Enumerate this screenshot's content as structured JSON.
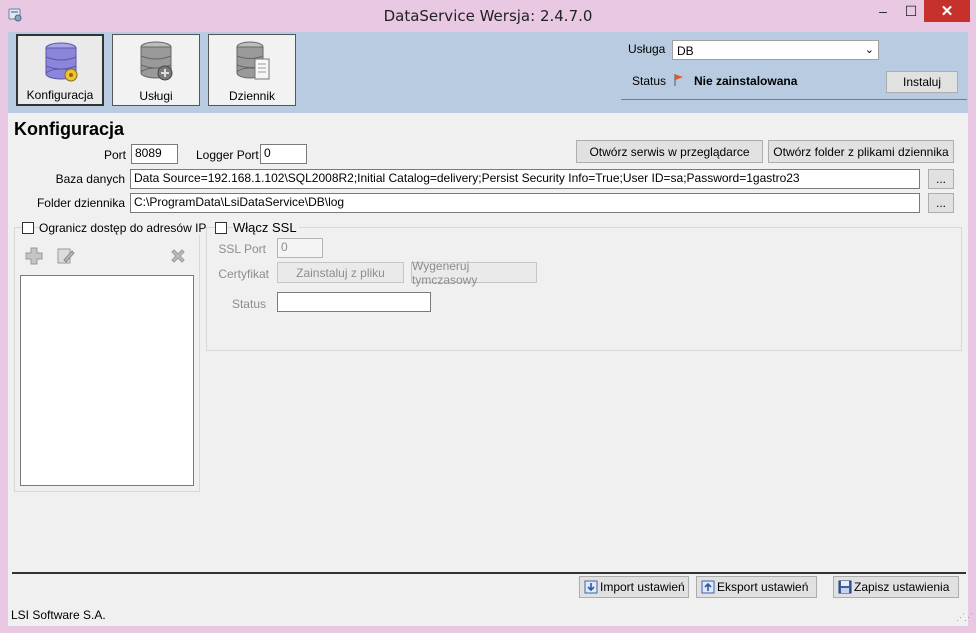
{
  "window": {
    "title": "DataService  Wersja: 2.4.7.0",
    "minimize": "–",
    "maximize": "☐",
    "close": "✕"
  },
  "toolbar": {
    "items": [
      {
        "label": "Konfiguracja",
        "icon": "database-config-icon",
        "active": true
      },
      {
        "label": "Usługi",
        "icon": "database-services-icon",
        "active": false
      },
      {
        "label": "Dziennik",
        "icon": "database-log-icon",
        "active": false
      }
    ]
  },
  "service": {
    "label": "Usługa",
    "selected": "DB",
    "status_label": "Status",
    "status_value": "Nie zainstalowana",
    "install_button": "Instaluj"
  },
  "config": {
    "title": "Konfiguracja",
    "port_label": "Port",
    "port_value": "8089",
    "logger_port_label": "Logger Port",
    "logger_port_value": "0",
    "open_browser_button": "Otwórz serwis w przeglądarce",
    "open_log_folder_button": "Otwórz folder z plikami dziennika",
    "db_label": "Baza danych",
    "db_value": "Data Source=192.168.1.102\\SQL2008R2;Initial Catalog=delivery;Persist Security Info=True;User ID=sa;Password=1gastro23",
    "log_folder_label": "Folder dziennika",
    "log_folder_value": "C:\\ProgramData\\LsiDataService\\DB\\log",
    "browse_label": "..."
  },
  "ip_access": {
    "checkbox_label": "Ogranicz dostęp do adresów IP",
    "checked": false
  },
  "ssl": {
    "checkbox_label": "Włącz SSL",
    "checked": false,
    "port_label": "SSL Port",
    "port_value": "0",
    "cert_label": "Certyfikat",
    "install_from_file": "Zainstaluj z pliku",
    "generate_temp": "Wygeneruj tymczasowy",
    "status_label": "Status",
    "status_value": ""
  },
  "footer": {
    "import_button": "Import ustawień",
    "export_button": "Eksport ustawień",
    "save_button": "Zapisz ustawienia"
  },
  "statusbar": {
    "text": "LSI Software S.A."
  }
}
